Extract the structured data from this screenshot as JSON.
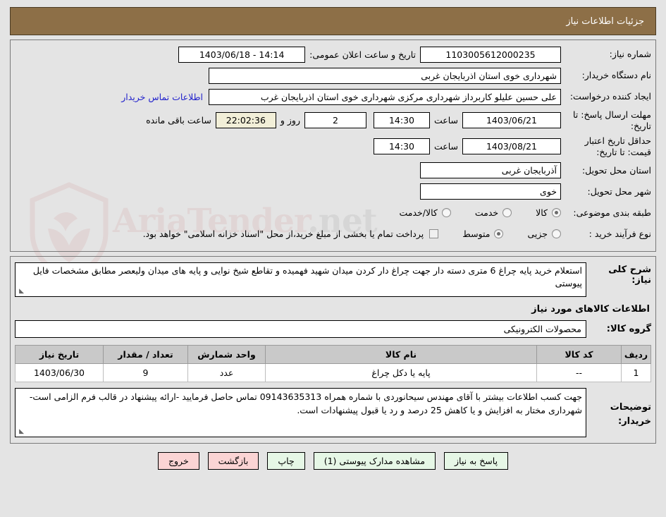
{
  "header": {
    "title": "جزئیات اطلاعات نیاز"
  },
  "form": {
    "need_number_label": "شماره نیاز:",
    "need_number_value": "1103005612000235",
    "public_announce_label": "تاریخ و ساعت اعلان عمومی:",
    "public_announce_value": "14:14 - 1403/06/18",
    "buyer_org_label": "نام دستگاه خریدار:",
    "buyer_org_value": "شهرداری خوی استان اذربایجان غربی",
    "creator_label": "ایجاد کننده درخواست:",
    "creator_value": "علی حسین علیلو کاربرداز شهرداری مرکزی شهرداری خوی استان اذربایجان غرب",
    "contact_link": "اطلاعات تماس خریدار",
    "deadline_label": "مهلت ارسال پاسخ: تا تاریخ:",
    "deadline_date": "1403/06/21",
    "hour_label": "ساعت",
    "deadline_time": "14:30",
    "days_remaining": "2",
    "days_word": "روز و",
    "countdown": "22:02:36",
    "remaining_word": "ساعت باقی مانده",
    "price_validity_label": "حداقل تاریخ اعتبار قیمت: تا تاریخ:",
    "price_validity_date": "1403/08/21",
    "price_validity_time": "14:30",
    "province_label": "استان محل تحویل:",
    "province_value": "آذربایجان غربی",
    "city_label": "شهر محل تحویل:",
    "city_value": "خوی",
    "category_label": "طبقه بندی موضوعی:",
    "category_options": [
      "کالا",
      "خدمت",
      "کالا/خدمت"
    ],
    "category_selected": "کالا",
    "process_label": "نوع فرآیند خرید :",
    "process_options": [
      "جزیی",
      "متوسط",
      "پرداخت"
    ],
    "process_selected": "متوسط",
    "treasury_checkbox_text": "پرداخت تمام یا بخشی از مبلغ خرید،از محل \"اسناد خزانه اسلامی\" خواهد بود.",
    "treasury_checked": false
  },
  "body": {
    "description_label": "شرح کلی نیاز:",
    "description_value": "استعلام خرید پایه چراغ 6 متری دسته دار جهت چراغ دار کردن میدان شهید فهمیده و تقاطع شیخ نوایی و پایه های میدان ولیعصر مطابق مشخصات فایل پیوستی",
    "items_heading": "اطلاعات کالاهای مورد نیاز",
    "group_label": "گروه کالا:",
    "group_value": "محصولات الکترونیکی",
    "notes_label": "توضیحات خریدار:",
    "notes_value": "جهت کسب اطلاعات بیشتر با آقای مهندس سیحانوردی با شماره همراه 09143635313 تماس حاصل فرمایید -ارائه پیشنهاد در قالب فرم الزامی است-شهرداری مختار به افزایش و یا کاهش 25 درصد و رد یا قبول پیشنهادات است."
  },
  "table": {
    "columns": [
      "ردیف",
      "کد کالا",
      "نام کالا",
      "واحد شمارش",
      "تعداد / مقدار",
      "تاریخ نیاز"
    ],
    "rows": [
      {
        "radif": "1",
        "code": "--",
        "name": "پایه یا دکل چراغ",
        "unit": "عدد",
        "qty": "9",
        "date": "1403/06/30"
      }
    ]
  },
  "footer": {
    "buttons": [
      {
        "label": "پاسخ به نیاز",
        "style": "green"
      },
      {
        "label": "مشاهده مدارک پیوستی (1)",
        "style": "green"
      },
      {
        "label": "چاپ",
        "style": "green"
      },
      {
        "label": "بازگشت",
        "style": "pink"
      },
      {
        "label": "خروج",
        "style": "pink"
      }
    ]
  },
  "watermark": {
    "text_a": "AriaTender",
    "text_b": ".net"
  }
}
